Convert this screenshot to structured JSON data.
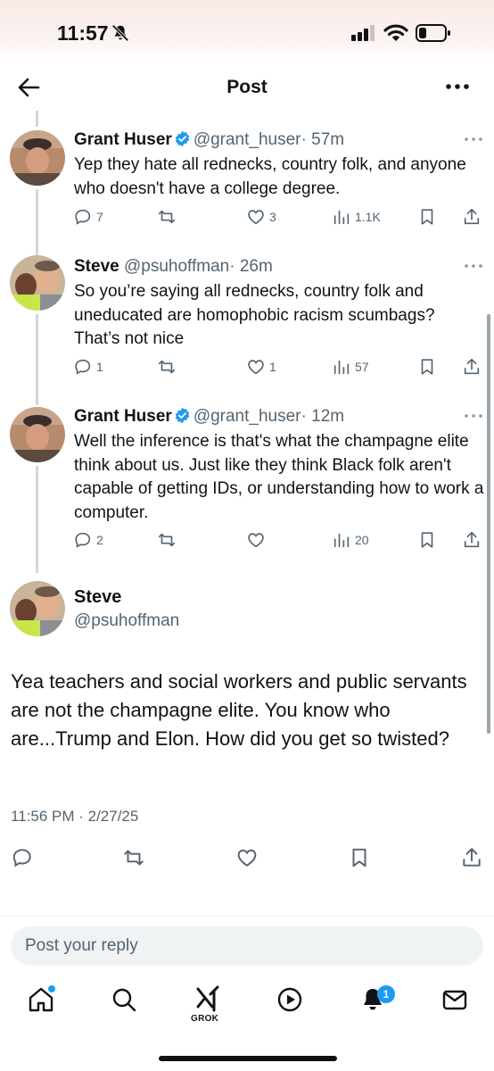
{
  "status_bar": {
    "time": "11:57"
  },
  "header": {
    "title": "Post"
  },
  "replies": [
    {
      "name": "Grant Huser",
      "verified": true,
      "handle": "@grant_huser",
      "time": "· 57m",
      "text": "Yep they hate all rednecks, country folk, and anyone who doesn't have a college degree.",
      "replies": "7",
      "retweets": "",
      "likes": "3",
      "views": "1.1K"
    },
    {
      "name": "Steve",
      "verified": false,
      "handle": "@psuhoffman",
      "time": "· 26m",
      "text": "So you’re saying all rednecks, country folk and uneducated are homophobic racism scumbags? That’s not nice",
      "replies": "1",
      "retweets": "",
      "likes": "1",
      "views": "57"
    },
    {
      "name": "Grant Huser",
      "verified": true,
      "handle": "@grant_huser",
      "time": "· 12m",
      "text": "Well the inference is that's what the champagne elite think about us. Just like they think Black folk aren't capable of getting IDs, or understanding how to work a computer.",
      "replies": "2",
      "retweets": "",
      "likes": "",
      "views": "20"
    }
  ],
  "main_post": {
    "name": "Steve",
    "handle": "@psuhoffman",
    "text": "Yea teachers and social workers and public servants are not the champagne elite. You know who are...Trump and Elon. How did you get so twisted?",
    "timestamp": "11:56 PM · 2/27/25"
  },
  "reply_box": {
    "placeholder": "Post your reply"
  },
  "tab_bar": {
    "grok_label": "GROK",
    "notification_count": "1"
  },
  "colors": {
    "accent": "#1d9bf0",
    "secondary_text": "#536471",
    "primary_text": "#0f1419"
  }
}
